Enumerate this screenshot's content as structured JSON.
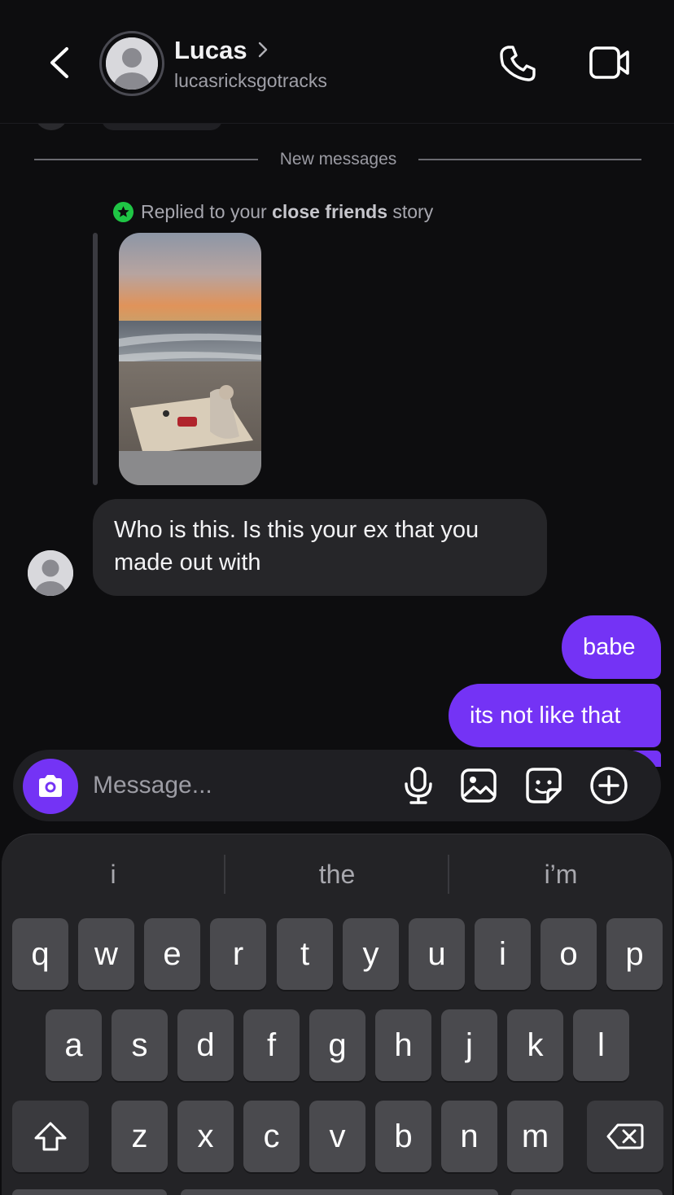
{
  "header": {
    "name": "Lucas",
    "handle": "lucasricksgotracks"
  },
  "chat": {
    "divider": "New messages",
    "reply_context": {
      "prefix": "Replied to your ",
      "bold": "close friends",
      "suffix": " story"
    },
    "incoming": [
      {
        "text": "Who is this. Is this your ex that you made out with"
      }
    ],
    "outgoing": [
      {
        "text": "babe"
      },
      {
        "text": "its not like that"
      }
    ]
  },
  "composer": {
    "placeholder": "Message..."
  },
  "keyboard": {
    "suggestions": [
      "i",
      "the",
      "i’m"
    ],
    "row1": [
      "q",
      "w",
      "e",
      "r",
      "t",
      "y",
      "u",
      "i",
      "o",
      "p"
    ],
    "row2": [
      "a",
      "s",
      "d",
      "f",
      "g",
      "h",
      "j",
      "k",
      "l"
    ],
    "row3": [
      "z",
      "x",
      "c",
      "v",
      "b",
      "n",
      "m"
    ]
  },
  "colors": {
    "background": "#0d0d0f",
    "accent": "#7433f5",
    "incoming_bubble": "#262629",
    "close_friends_badge": "#1fc545",
    "keyboard": "#232326",
    "key": "#4a4a4e"
  },
  "icons": {
    "back": "chevron-left-icon",
    "call": "phone-icon",
    "video": "video-camera-icon",
    "camera": "camera-icon",
    "mic": "microphone-icon",
    "gallery": "image-icon",
    "sticker": "sticker-icon",
    "plus": "plus-circle-icon",
    "shift": "shift-icon",
    "delete": "backspace-icon"
  }
}
